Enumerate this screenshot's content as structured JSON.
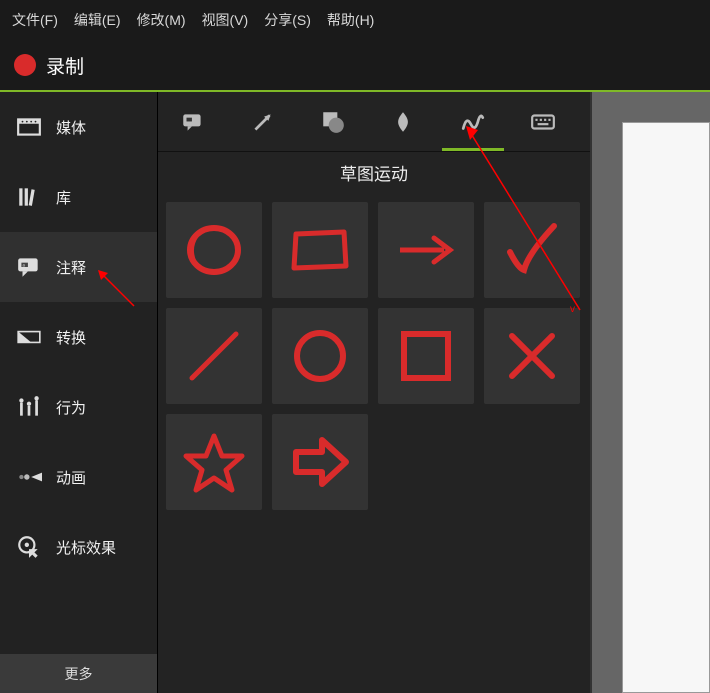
{
  "menu": {
    "file": "文件(F)",
    "edit": "编辑(E)",
    "modify": "修改(M)",
    "view": "视图(V)",
    "share": "分享(S)",
    "help": "帮助(H)"
  },
  "record_label": "录制",
  "sidebar": {
    "items": [
      {
        "label": "媒体"
      },
      {
        "label": "库"
      },
      {
        "label": "注释"
      },
      {
        "label": "转换"
      },
      {
        "label": "行为"
      },
      {
        "label": "动画"
      },
      {
        "label": "光标效果"
      }
    ],
    "more": "更多"
  },
  "panel": {
    "title": "草图运动",
    "shapes": [
      "sketch-circle",
      "sketch-rectangle",
      "sketch-arrow-right",
      "sketch-check",
      "sketch-line",
      "circle-outline",
      "square-outline",
      "cross",
      "star",
      "block-arrow-right"
    ]
  },
  "tools": [
    "callout-tool",
    "arrow-tool",
    "shape-tool",
    "blur-tool",
    "sketch-tool",
    "keyboard-tool"
  ]
}
